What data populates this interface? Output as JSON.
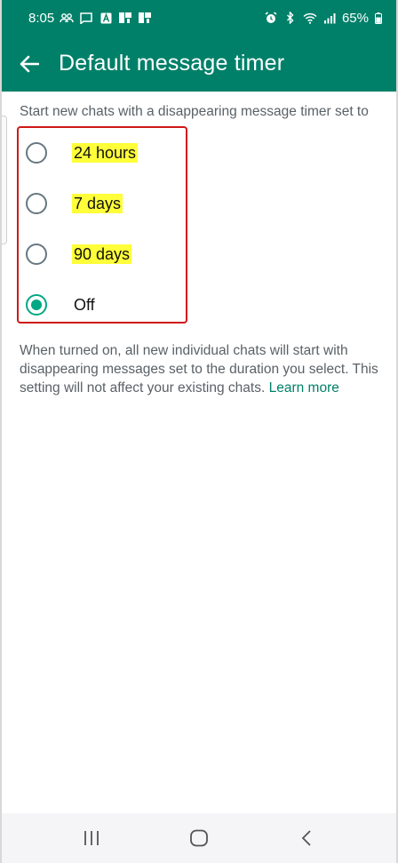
{
  "status_bar": {
    "time": "8:05",
    "battery": "65%",
    "left_icons": [
      "group-icon",
      "chat-icon",
      "a-box-icon",
      "photo-icon",
      "photo-icon"
    ],
    "right_icons": [
      "alarm-icon",
      "bluetooth-icon",
      "wifi-icon",
      "signal-icon",
      "battery-icon"
    ]
  },
  "app_bar": {
    "title": "Default message timer",
    "back_icon": "arrow-left-icon"
  },
  "intro_text": "Start new chats with a disappearing message timer set to",
  "options": [
    {
      "label": "24 hours",
      "selected": false,
      "highlighted": true
    },
    {
      "label": "7 days",
      "selected": false,
      "highlighted": true
    },
    {
      "label": "90 days",
      "selected": false,
      "highlighted": true
    },
    {
      "label": "Off",
      "selected": true,
      "highlighted": false
    }
  ],
  "footnote": {
    "text": "When turned on, all new individual chats will start with disappearing messages set to the duration you select. This setting will not affect your existing chats.",
    "link": "Learn more"
  },
  "colors": {
    "brand": "#008069",
    "radio_selected": "#00a884",
    "highlight": "#ffff3a",
    "annotation_box": "#d01818"
  },
  "nav_bar": {
    "icons": [
      "recent-apps-icon",
      "home-icon",
      "back-icon"
    ]
  }
}
